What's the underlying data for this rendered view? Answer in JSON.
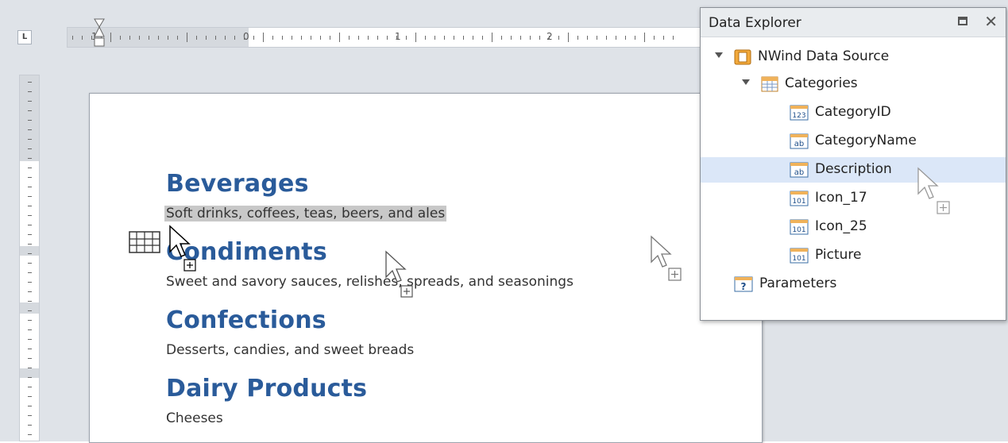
{
  "ruler": {
    "corner_label": "L",
    "numbers": [
      "1",
      "0",
      "1",
      "2"
    ]
  },
  "document": {
    "categories": [
      {
        "name": "Beverages",
        "description": "Soft drinks, coffees, teas, beers, and ales",
        "selected": true
      },
      {
        "name": "Condiments",
        "description": "Sweet and savory sauces, relishes, spreads, and seasonings",
        "selected": false
      },
      {
        "name": "Confections",
        "description": "Desserts, candies, and sweet breads",
        "selected": false
      },
      {
        "name": "Dairy Products",
        "description": "Cheeses",
        "selected": false
      }
    ]
  },
  "data_explorer": {
    "title": "Data Explorer",
    "maximize_icon": "maximize-icon",
    "close_icon": "close-icon",
    "tree": {
      "source": {
        "label": "NWind Data Source",
        "icon": "database-icon"
      },
      "table": {
        "label": "Categories",
        "icon": "table-icon"
      },
      "fields": [
        {
          "label": "CategoryID",
          "type_badge": "123",
          "icon": "numeric-field-icon"
        },
        {
          "label": "CategoryName",
          "type_badge": "ab",
          "icon": "string-field-icon"
        },
        {
          "label": "Description",
          "type_badge": "ab",
          "icon": "string-field-icon",
          "highlighted": true
        },
        {
          "label": "Icon_17",
          "type_badge": "101",
          "icon": "binary-field-icon"
        },
        {
          "label": "Icon_25",
          "type_badge": "101",
          "icon": "binary-field-icon"
        },
        {
          "label": "Picture",
          "type_badge": "101",
          "icon": "binary-field-icon"
        }
      ],
      "parameters": {
        "label": "Parameters",
        "icon": "parameters-icon",
        "badge": "?"
      }
    }
  },
  "colors": {
    "heading": "#2a5b9a",
    "selection": "#c8c8c8",
    "tree_highlight": "#dbe7f8"
  }
}
